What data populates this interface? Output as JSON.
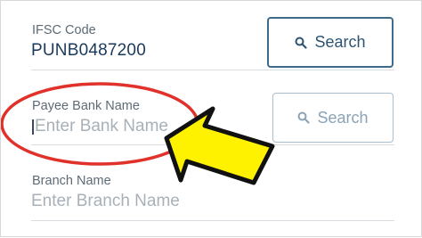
{
  "ifsc": {
    "label": "IFSC Code",
    "value": "PUNB0487200",
    "search_label": "Search"
  },
  "payee_bank": {
    "label": "Payee Bank Name",
    "placeholder": "Enter Bank Name",
    "search_label": "Search"
  },
  "branch": {
    "label": "Branch Name",
    "placeholder": "Enter Branch Name"
  },
  "annotation": {
    "highlight": "red-ellipse",
    "pointer": "yellow-arrow"
  },
  "colors": {
    "value_text": "#1a3a5c",
    "label_text": "#5d6b77",
    "placeholder_text": "#a8b0b8",
    "active_button_border": "#3e6b8a",
    "inactive_button_border": "#a9bdca",
    "active_button_text": "#2c5472",
    "inactive_button_text": "#8aa3b5",
    "annotation_red": "#e0322b",
    "annotation_yellow": "#fff200"
  }
}
